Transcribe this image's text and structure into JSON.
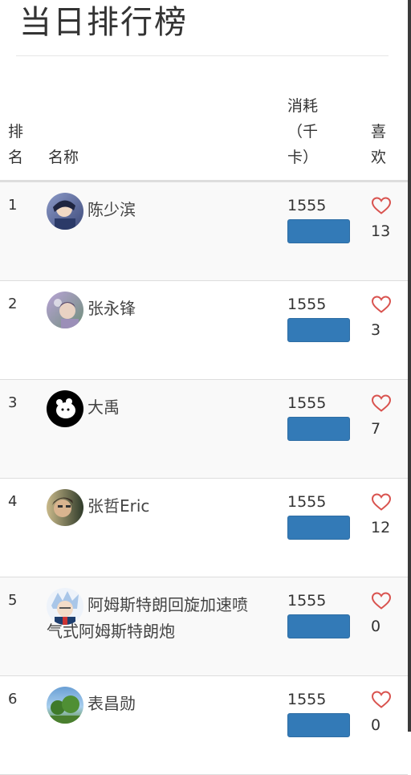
{
  "page": {
    "title": "当日排行榜"
  },
  "table": {
    "headers": {
      "rank": "排名",
      "name": "名称",
      "energy": "消耗（千卡）",
      "likes": "喜欢"
    },
    "rows": [
      {
        "rank": "1",
        "name": "陈少滨",
        "energy": "1555",
        "likes": "13",
        "avatar": "user-avatar"
      },
      {
        "rank": "2",
        "name": "张永锋",
        "energy": "1555",
        "likes": "3",
        "avatar": "user-avatar"
      },
      {
        "rank": "3",
        "name": "大禹",
        "energy": "1555",
        "likes": "7",
        "avatar": "user-avatar"
      },
      {
        "rank": "4",
        "name": "张哲Eric",
        "energy": "1555",
        "likes": "12",
        "avatar": "user-avatar"
      },
      {
        "rank": "5",
        "name": "阿姆斯特朗回旋加速喷气式阿姆斯特朗炮",
        "energy": "1555",
        "likes": "0",
        "avatar": "user-avatar"
      },
      {
        "rank": "6",
        "name": "表昌勋",
        "energy": "1555",
        "likes": "0",
        "avatar": "user-avatar"
      }
    ]
  },
  "icons": {
    "like": "heart-icon"
  },
  "colors": {
    "bar": "#337ab7",
    "heart": "#d9534f",
    "stripe": "#f9f9f9",
    "rule": "#dddddd"
  }
}
